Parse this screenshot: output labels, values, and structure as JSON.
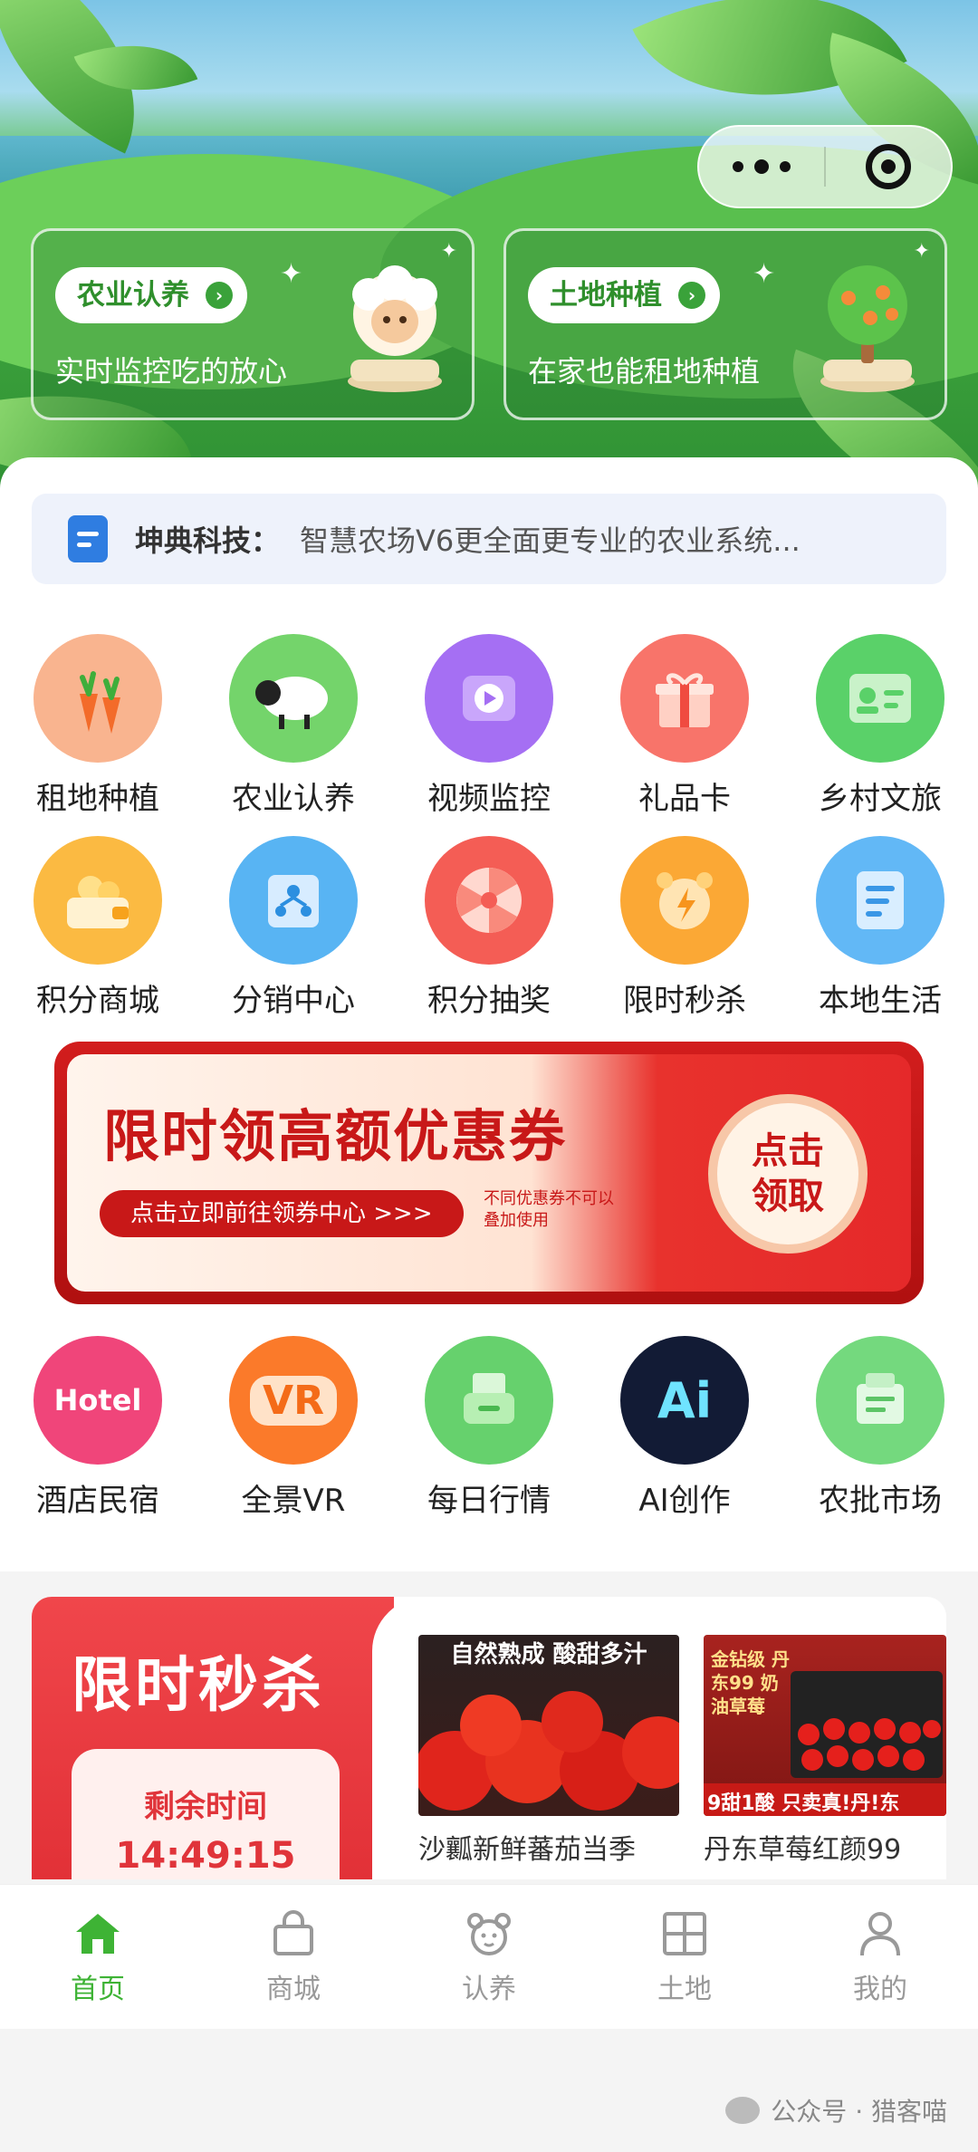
{
  "hero": {
    "promos": [
      {
        "tag": "农业认养",
        "desc": "实时监控吃的放心",
        "art": "sheep-icon"
      },
      {
        "tag": "土地种植",
        "desc": "在家也能租地种植",
        "art": "tree-icon"
      }
    ]
  },
  "notice": {
    "label": "坤典科技：",
    "text": "智慧农场V6更全面更专业的农业系统..."
  },
  "menu_row1": [
    {
      "label": "租地种植",
      "icon": "carrot-icon",
      "color": "#f9a77c"
    },
    {
      "label": "农业认养",
      "icon": "sheep-icon",
      "color": "#6fd06a"
    },
    {
      "label": "视频监控",
      "icon": "video-icon",
      "color": "#a46cf2"
    },
    {
      "label": "礼品卡",
      "icon": "gift-icon",
      "color": "#f77066"
    },
    {
      "label": "乡村文旅",
      "icon": "id-card-icon",
      "color": "#57cf67"
    }
  ],
  "menu_row2": [
    {
      "label": "积分商城",
      "icon": "wallet-icon",
      "color": "#fbb73d"
    },
    {
      "label": "分销中心",
      "icon": "distribution-icon",
      "color": "#52b1f2"
    },
    {
      "label": "积分抽奖",
      "icon": "wheel-icon",
      "color": "#f45c54"
    },
    {
      "label": "限时秒杀",
      "icon": "alarm-icon",
      "color": "#fba531"
    },
    {
      "label": "本地生活",
      "icon": "note-icon",
      "color": "#5cb4f5"
    }
  ],
  "coupon": {
    "title": "限时领高额优惠券",
    "sub": "点击立即前往领券中心 >>>",
    "note": "不同优惠券不可以叠加使用",
    "button": "点击领取"
  },
  "menu_row3": [
    {
      "label": "酒店民宿",
      "icon": "hotel-icon",
      "color": "#f0457a",
      "glyph": "Hotel"
    },
    {
      "label": "全景VR",
      "icon": "vr-icon",
      "color": "#fb7a2a",
      "glyph": "VR"
    },
    {
      "label": "每日行情",
      "icon": "printer-icon",
      "color": "#62d06a",
      "glyph": ""
    },
    {
      "label": "AI创作",
      "icon": "ai-icon",
      "color": "#121b35",
      "glyph": "Ai"
    },
    {
      "label": "农批市场",
      "icon": "market-icon",
      "color": "#6fd77a",
      "glyph": ""
    }
  ],
  "flash_sale": {
    "title": "限时秒杀",
    "remaining_label": "剩余时间",
    "countdown": "14:49:15",
    "products": [
      {
        "name": "沙瓤新鲜蕃茄当季",
        "badge": "自然熟成 酸甜多汁"
      },
      {
        "name": "丹东草莓红颜99",
        "badge": "金钻级 丹东99 奶油草莓",
        "tag": "9甜1酸 只卖真!丹!东"
      }
    ]
  },
  "tabbar": [
    {
      "label": "首页",
      "icon": "home-icon",
      "active": true
    },
    {
      "label": "商城",
      "icon": "bag-icon",
      "active": false
    },
    {
      "label": "认养",
      "icon": "bear-icon",
      "active": false
    },
    {
      "label": "土地",
      "icon": "grid-icon",
      "active": false
    },
    {
      "label": "我的",
      "icon": "user-icon",
      "active": false
    }
  ],
  "watermark": "公众号 · 猎客喵"
}
